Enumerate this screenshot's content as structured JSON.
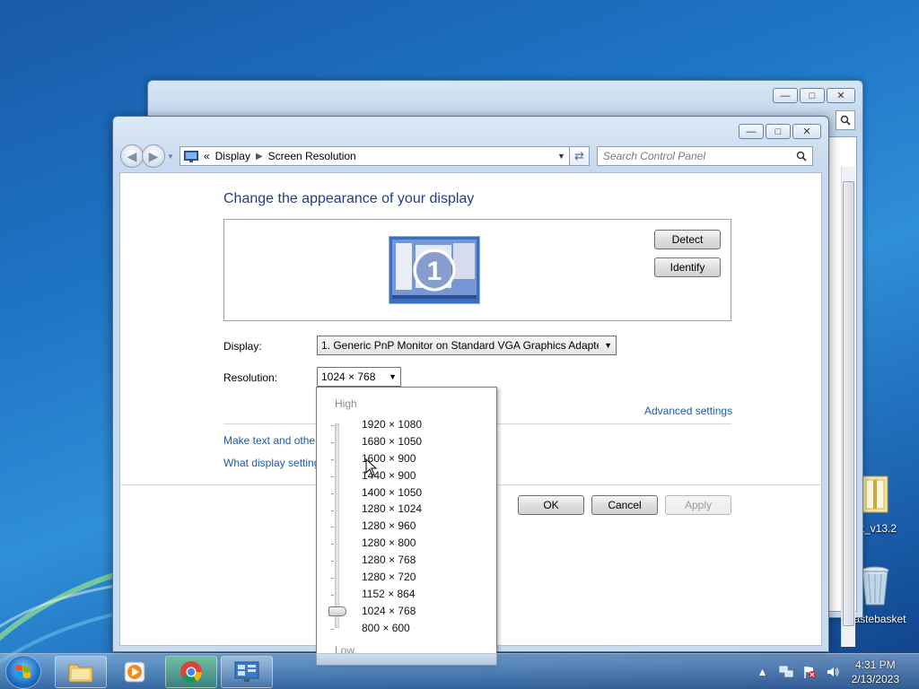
{
  "desktop": {
    "icons": [
      {
        "label": "kit_v13.2"
      },
      {
        "label": "Wastebasket"
      }
    ]
  },
  "window": {
    "address": {
      "chevron": "«",
      "crumbs": [
        "Display",
        "Screen Resolution"
      ]
    },
    "search_placeholder": "Search Control Panel",
    "heading": "Change the appearance of your display",
    "monitor_number": "1",
    "detect_label": "Detect",
    "identify_label": "Identify",
    "display_label": "Display:",
    "display_value": "1. Generic PnP Monitor on Standard VGA Graphics Adapter",
    "resolution_label": "Resolution:",
    "resolution_value": "1024 × 768",
    "advanced_link": "Advanced settings",
    "link_text_size": "Make text and other",
    "link_display_settings": "What display setting",
    "ok_label": "OK",
    "cancel_label": "Cancel",
    "apply_label": "Apply"
  },
  "resolution_popup": {
    "high_label": "High",
    "low_label": "Low",
    "options": [
      "1920 × 1080",
      "1680 × 1050",
      "1600 × 900",
      "1440 × 900",
      "1400 × 1050",
      "1280 × 1024",
      "1280 × 960",
      "1280 × 800",
      "1280 × 768",
      "1280 × 720",
      "1152 × 864",
      "1024 × 768",
      "800 × 600"
    ],
    "selected": "1024 × 768"
  },
  "taskbar": {
    "apps": [
      "start-orb",
      "windows-explorer",
      "media-player",
      "chrome",
      "control-panel"
    ],
    "clock_time": "4:31 PM",
    "clock_date": "2/13/2023"
  }
}
